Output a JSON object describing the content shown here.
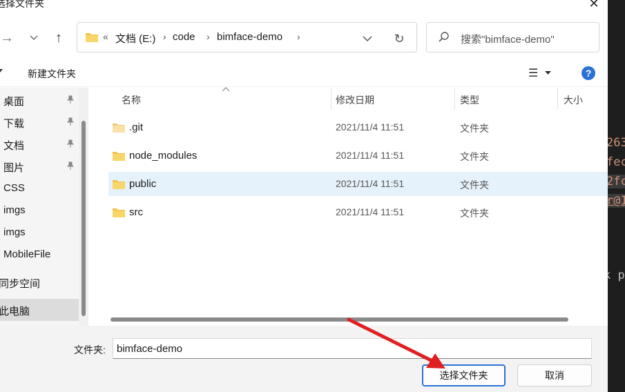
{
  "dialog": {
    "title": "选择文件夹",
    "close_symbol": "✕"
  },
  "nav": {
    "forward_symbol": "→",
    "dropdown_symbol": "⌄",
    "up_symbol": "↑",
    "address": {
      "overflow": "«",
      "crumbs": [
        "文档 (E:)",
        "code",
        "bimface-demo"
      ],
      "separator": "›"
    },
    "refresh_symbol": "↻",
    "search_placeholder": "搜索\"bimface-demo\""
  },
  "toolbar": {
    "new_folder": "新建文件夹",
    "view_symbol": "☰",
    "help_symbol": "?"
  },
  "sidebar": {
    "items": [
      {
        "label": "桌面",
        "pinned": true
      },
      {
        "label": "下载",
        "pinned": true
      },
      {
        "label": "文档",
        "pinned": true
      },
      {
        "label": "图片",
        "pinned": true
      },
      {
        "label": "CSS",
        "pinned": false
      },
      {
        "label": "imgs",
        "pinned": false
      },
      {
        "label": "imgs",
        "pinned": false
      },
      {
        "label": "MobileFile",
        "pinned": false
      },
      {
        "label": "同步空间",
        "pinned": false
      },
      {
        "label": "此电脑",
        "pinned": false,
        "selected": true
      }
    ],
    "pin_symbol": "📌"
  },
  "filelist": {
    "columns": [
      "名称",
      "修改日期",
      "类型",
      "大小"
    ],
    "rows": [
      {
        "name": ".git",
        "date": "2021/11/4 11:51",
        "type": "文件夹",
        "selected": false
      },
      {
        "name": "node_modules",
        "date": "2021/11/4 11:51",
        "type": "文件夹",
        "selected": false
      },
      {
        "name": "public",
        "date": "2021/11/4 11:51",
        "type": "文件夹",
        "selected": true
      },
      {
        "name": "src",
        "date": "2021/11/4 11:51",
        "type": "文件夹",
        "selected": false
      }
    ]
  },
  "footer": {
    "folder_label": "文件夹:",
    "folder_value": "bimface-demo",
    "select_button": "选择文件夹",
    "cancel_button": "取消"
  },
  "background_terminal": {
    "lines": [
      "263",
      "fec",
      "2fc",
      "r@1",
      "k p"
    ]
  },
  "colors": {
    "accent": "#2a72d5",
    "selection": "#e5f1fb",
    "folder": "#f4c04c",
    "annotation_arrow": "#e02020"
  }
}
